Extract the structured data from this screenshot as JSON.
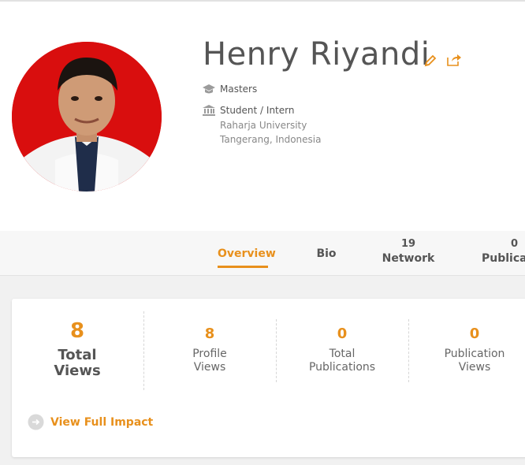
{
  "profile": {
    "name": "Henry Riyandi",
    "degree": "Masters",
    "position": "Student / Intern",
    "institution": "Raharja University",
    "location": "Tangerang, Indonesia"
  },
  "tabs": [
    {
      "label": "Overview",
      "count": "",
      "active": true
    },
    {
      "label": "Bio",
      "count": ""
    },
    {
      "label": "Network",
      "count": "19"
    },
    {
      "label": "Publicat",
      "count": "0"
    }
  ],
  "impact": {
    "total_views": {
      "value": "8",
      "label_line1": "Total",
      "label_line2": "Views"
    },
    "profile_views": {
      "value": "8",
      "label_line1": "Profile",
      "label_line2": "Views"
    },
    "total_publications": {
      "value": "0",
      "label_line1": "Total",
      "label_line2": "Publications"
    },
    "publication_views": {
      "value": "0",
      "label_line1": "Publication",
      "label_line2": "Views"
    },
    "view_full_impact_label": "View Full Impact"
  },
  "icons": {
    "degree": "graduation-cap-icon",
    "position": "institution-icon",
    "edit": "pencil-icon",
    "share": "share-icon",
    "impact_link": "arrow-circle-icon"
  },
  "colors": {
    "accent": "#e8901c",
    "avatar_background": "#d90e0e"
  }
}
